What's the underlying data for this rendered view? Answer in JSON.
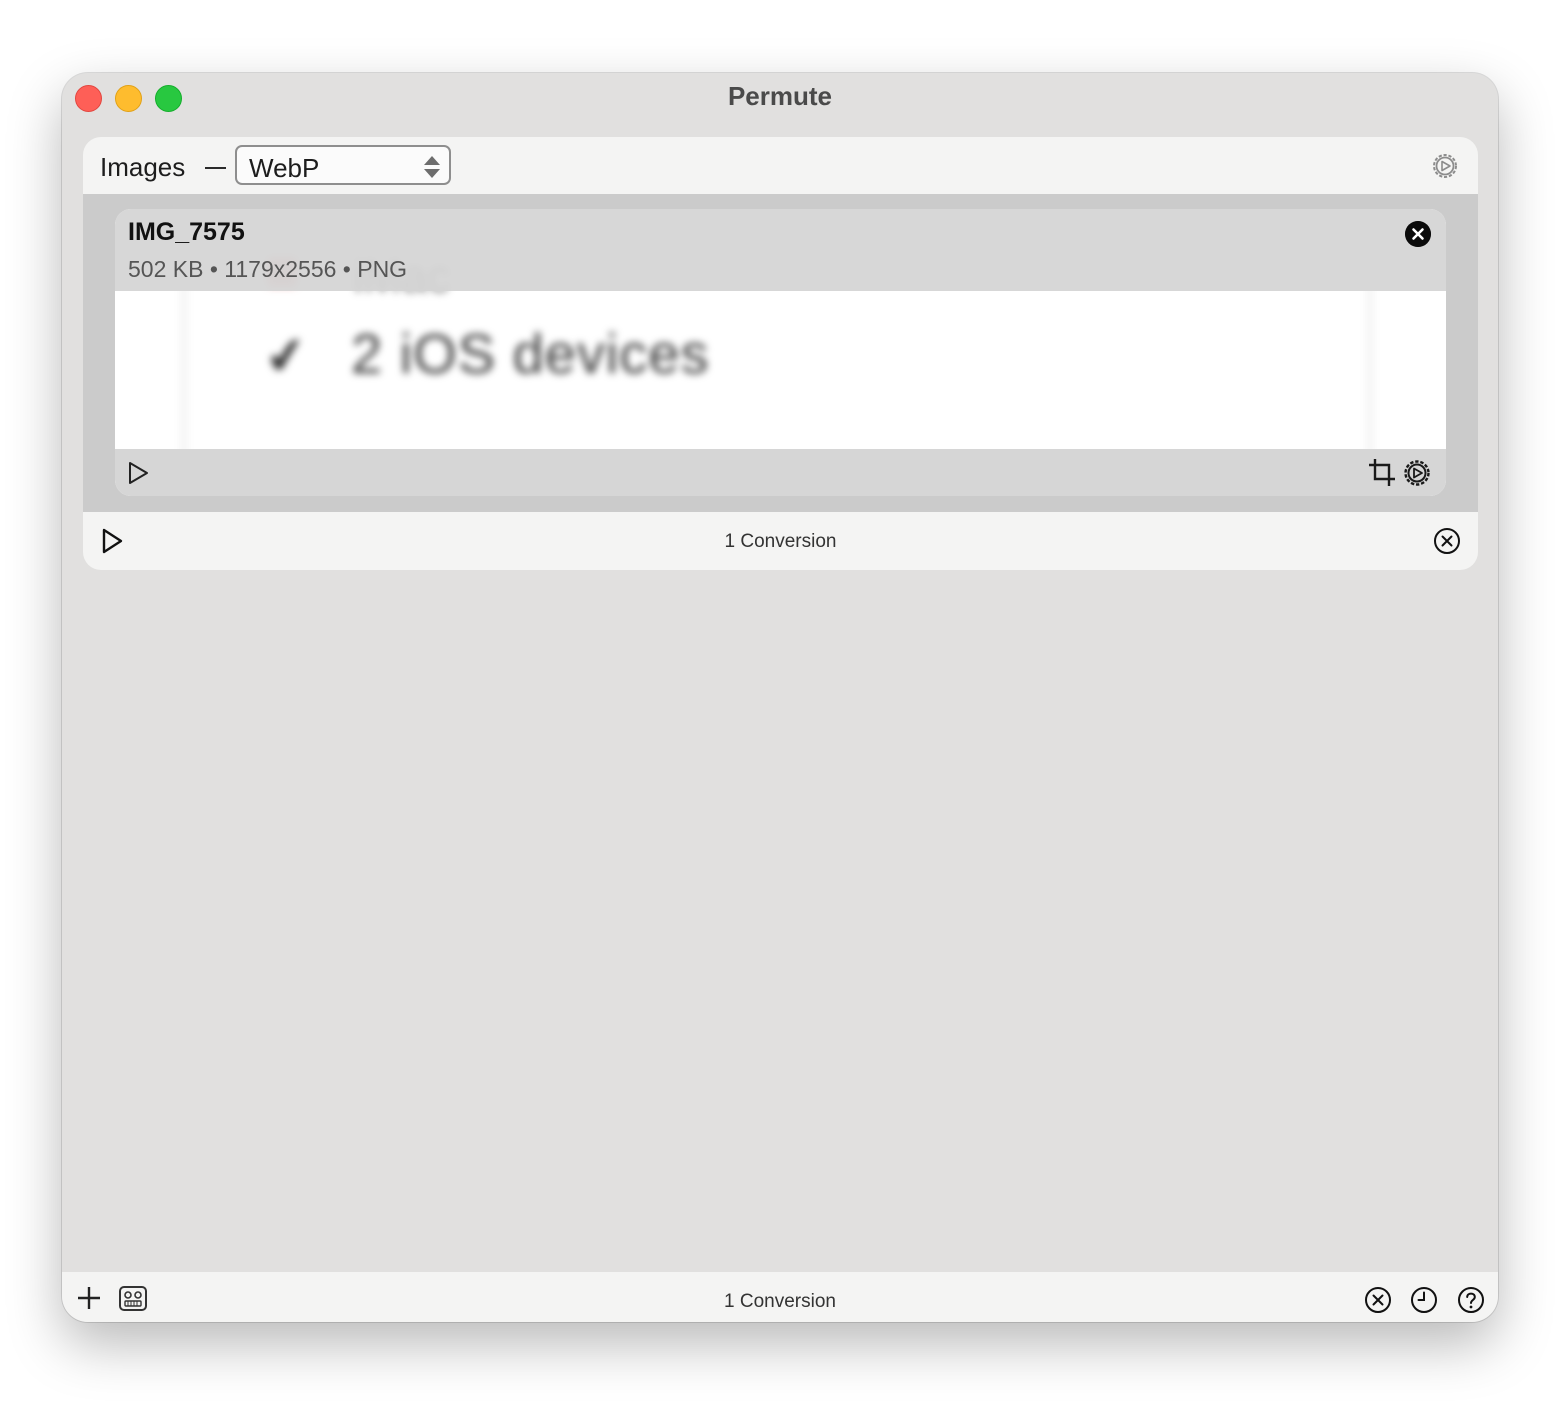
{
  "window": {
    "title": "Permute"
  },
  "toolbar": {
    "category_label": "Images",
    "format_select": {
      "value": "WebP"
    }
  },
  "file": {
    "name": "IMG_7575",
    "meta": "502 KB • 1179x2556 • PNG",
    "preview_text": "2 iOS devices"
  },
  "panel_footer": {
    "count": "1 Conversion"
  },
  "bottom_bar": {
    "count": "1 Conversion"
  },
  "icons": {
    "settings": "gear-icon",
    "play": "play-icon",
    "crop": "crop-icon",
    "remove": "close-icon",
    "cancel": "circle-x-icon",
    "add": "plus-icon",
    "presets": "preset-icon",
    "history": "clock-icon",
    "help": "question-icon"
  },
  "colors": {
    "close": "#fe5f57",
    "minimize": "#febc2e",
    "maximize": "#28c840",
    "window_bg": "#e1e0df"
  }
}
